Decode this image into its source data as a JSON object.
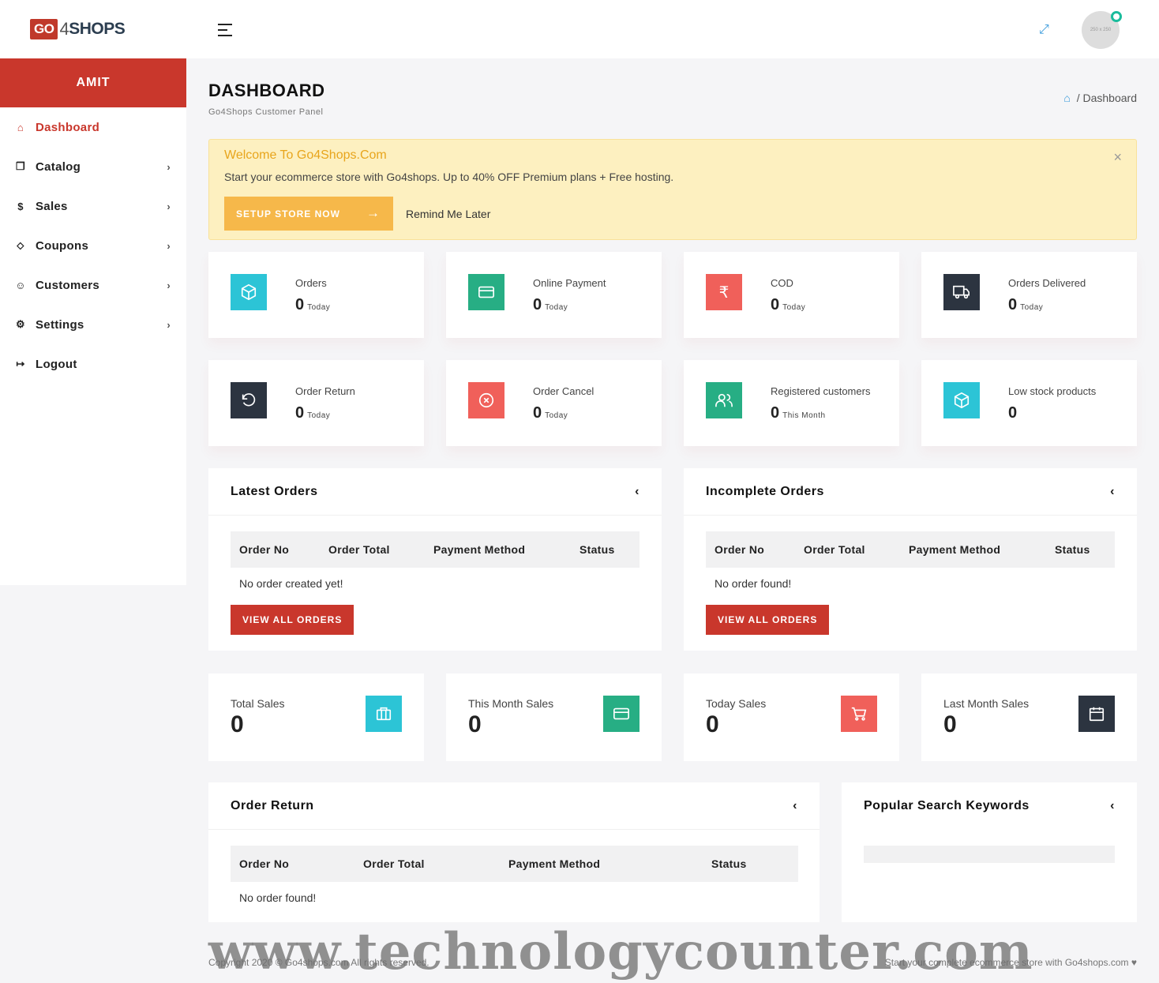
{
  "brand": {
    "go": "GO",
    "four": "4",
    "shops": "SHOPS"
  },
  "user": {
    "name": "AMIT"
  },
  "sidebar": {
    "items": [
      {
        "label": "Dashboard",
        "icon": "home-icon",
        "glyph": "⌂"
      },
      {
        "label": "Catalog",
        "icon": "box-icon",
        "glyph": "❒"
      },
      {
        "label": "Sales",
        "icon": "dollar-icon",
        "glyph": "$"
      },
      {
        "label": "Coupons",
        "icon": "tag-icon",
        "glyph": "⬦"
      },
      {
        "label": "Customers",
        "icon": "user-icon",
        "glyph": "☺"
      },
      {
        "label": "Settings",
        "icon": "gear-icon",
        "glyph": "⚙"
      },
      {
        "label": "Logout",
        "icon": "logout-icon",
        "glyph": "↦"
      }
    ]
  },
  "topbar": {
    "avatar_text": "250 x 250"
  },
  "page": {
    "title": "DASHBOARD",
    "subtitle": "Go4Shops Customer Panel",
    "breadcrumb": "Dashboard"
  },
  "alert": {
    "title": "Welcome To Go4Shops.Com",
    "message": "Start your ecommerce store with Go4shops. Up to 40% OFF Premium plans + Free hosting.",
    "setup_label": "SETUP STORE NOW",
    "remind_label": "Remind Me Later"
  },
  "stats": [
    {
      "label": "Orders",
      "value": "0",
      "period": "Today",
      "color": "#2cc4d6",
      "icon": "cube-icon"
    },
    {
      "label": "Online Payment",
      "value": "0",
      "period": "Today",
      "color": "#27ae84",
      "icon": "card-icon"
    },
    {
      "label": "COD",
      "value": "0",
      "period": "Today",
      "color": "#f0605a",
      "icon": "rupee-icon"
    },
    {
      "label": "Orders Delivered",
      "value": "0",
      "period": "Today",
      "color": "#2c3440",
      "icon": "truck-icon"
    },
    {
      "label": "Order Return",
      "value": "0",
      "period": "Today",
      "color": "#2c3440",
      "icon": "return-icon"
    },
    {
      "label": "Order Cancel",
      "value": "0",
      "period": "Today",
      "color": "#f0605a",
      "icon": "cancel-icon"
    },
    {
      "label": "Registered customers",
      "value": "0",
      "period": "This Month",
      "color": "#27ae84",
      "icon": "users-icon"
    },
    {
      "label": "Low stock products",
      "value": "0",
      "period": "",
      "color": "#2cc4d6",
      "icon": "cube-icon"
    }
  ],
  "latest_orders": {
    "title": "Latest Orders",
    "columns": [
      "Order No",
      "Order Total",
      "Payment Method",
      "Status"
    ],
    "empty": "No order created yet!",
    "button": "VIEW ALL ORDERS"
  },
  "incomplete_orders": {
    "title": "Incomplete Orders",
    "columns": [
      "Order No",
      "Order Total",
      "Payment Method",
      "Status"
    ],
    "empty": "No order found!",
    "button": "VIEW ALL ORDERS"
  },
  "sales": [
    {
      "label": "Total Sales",
      "value": "0",
      "color": "#2cc4d6",
      "icon": "briefcase-icon"
    },
    {
      "label": "This Month Sales",
      "value": "0",
      "color": "#27ae84",
      "icon": "card-icon"
    },
    {
      "label": "Today Sales",
      "value": "0",
      "color": "#f0605a",
      "icon": "cart-icon"
    },
    {
      "label": "Last Month Sales",
      "value": "0",
      "color": "#2c3440",
      "icon": "calendar-icon"
    }
  ],
  "order_return": {
    "title": "Order Return",
    "columns": [
      "Order No",
      "Order Total",
      "Payment Method",
      "Status"
    ],
    "empty": "No order found!"
  },
  "popular_keywords": {
    "title": "Popular Search Keywords"
  },
  "footer": {
    "left": "Copyright 2020 © Go4shops.com All rights reserved.",
    "right": "Start your complete ecommerce store with Go4shops.com ♥"
  },
  "watermark": "www.technologycounter.com"
}
